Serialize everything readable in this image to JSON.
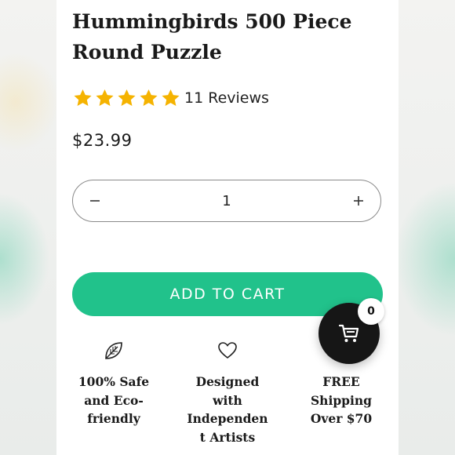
{
  "product": {
    "title": "Hummingbirds 500 Piece Round Puzzle",
    "rating": 5,
    "rating_max": 5,
    "reviews_label": "11 Reviews",
    "price": "$23.99"
  },
  "quantity": {
    "value": "1",
    "decrement_icon": "minus-icon",
    "increment_icon": "plus-icon"
  },
  "add_to_cart_label": "ADD TO CART",
  "features": [
    {
      "icon": "leaf-icon",
      "label": "100% Safe\nand Eco-\nfriendly"
    },
    {
      "icon": "heart-icon",
      "label": "Designed\nwith\nIndependen\nt Artists"
    },
    {
      "icon": "truck-icon",
      "label": "FREE\nShipping\nOver $70"
    }
  ],
  "cart": {
    "icon": "cart-icon",
    "count": "0"
  },
  "colors": {
    "accent": "#21c28b",
    "star": "#f5b301",
    "text": "#1a1a1a",
    "cart_button": "#161616"
  }
}
